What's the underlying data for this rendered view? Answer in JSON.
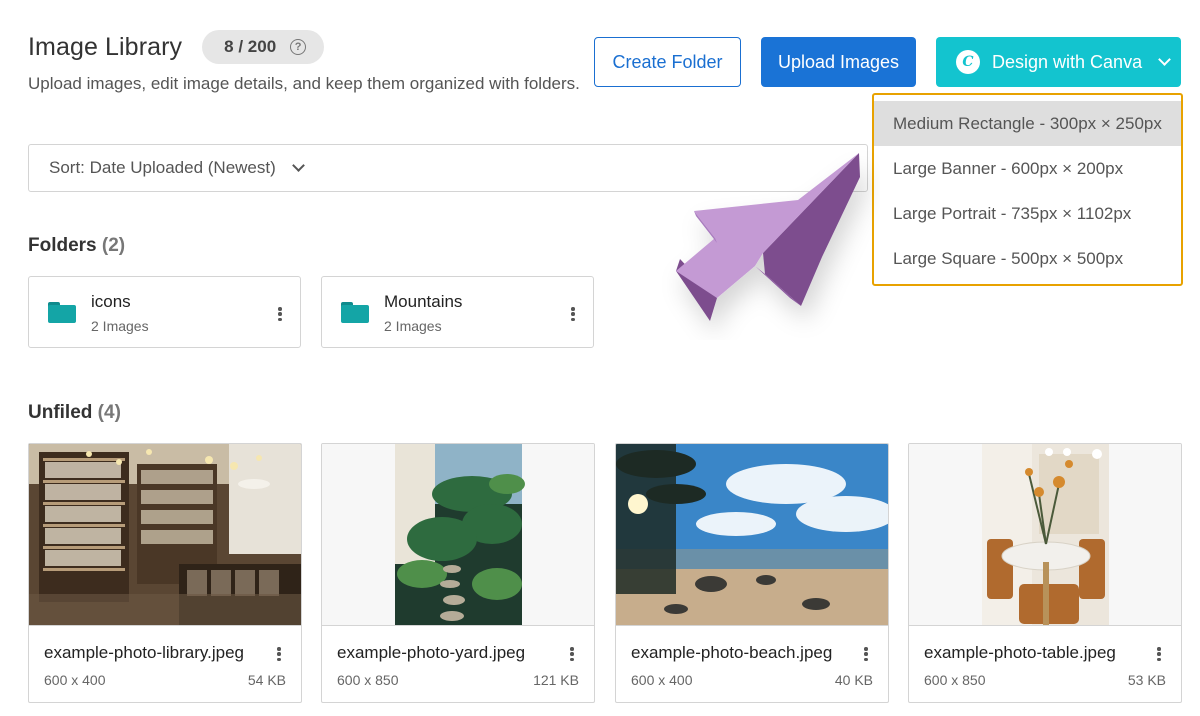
{
  "header": {
    "title": "Image Library",
    "count": "8 / 200",
    "help_icon": "?",
    "subtitle": "Upload images, edit image details, and keep them organized with folders."
  },
  "toolbar": {
    "create_folder_label": "Create Folder",
    "upload_images_label": "Upload Images",
    "canva_label": "Design with Canva",
    "canva_logo_letter": "C"
  },
  "canva_menu": {
    "items": [
      "Medium Rectangle - 300px × 250px",
      "Large Banner - 600px × 200px",
      "Large Portrait - 735px × 1102px",
      "Large Square - 500px × 500px"
    ]
  },
  "sort": {
    "label": "Sort: Date Uploaded (Newest)"
  },
  "folders": {
    "heading": "Folders",
    "count": "(2)",
    "items": [
      {
        "name": "icons",
        "sub": "2 Images"
      },
      {
        "name": "Mountains",
        "sub": "2 Images"
      }
    ]
  },
  "unfiled": {
    "heading": "Unfiled",
    "count": "(4)",
    "items": [
      {
        "name": "example-photo-library.jpeg",
        "dims": "600 x 400",
        "size": "54 KB"
      },
      {
        "name": "example-photo-yard.jpeg",
        "dims": "600 x 850",
        "size": "121 KB"
      },
      {
        "name": "example-photo-beach.jpeg",
        "dims": "600 x 400",
        "size": "40 KB"
      },
      {
        "name": "example-photo-table.jpeg",
        "dims": "600 x 850",
        "size": "53 KB"
      }
    ]
  },
  "colors": {
    "primary_blue": "#1a73d6",
    "canva_teal": "#13c4cf",
    "folder_teal": "#14a5a6",
    "highlight_orange": "#e8a200",
    "arrow_purple": "#c49ad4"
  }
}
